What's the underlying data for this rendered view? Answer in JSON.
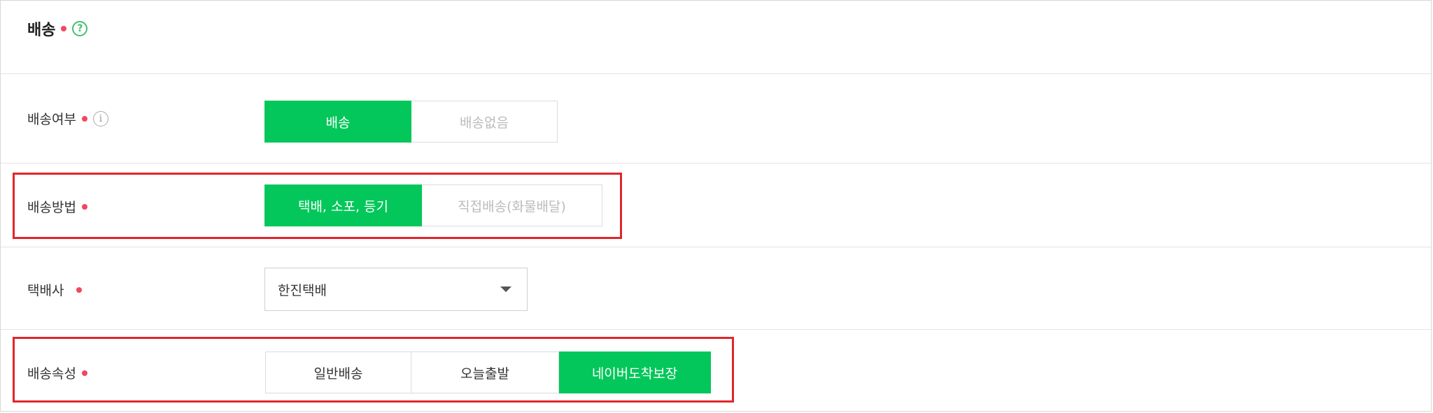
{
  "section": {
    "title": "배송",
    "help_icon": "question-circle-icon"
  },
  "rows": {
    "delivery_option": {
      "label": "배송여부",
      "info_icon": "info-circle-icon",
      "options": [
        "배송",
        "배송없음"
      ],
      "selected": "배송"
    },
    "delivery_method": {
      "label": "배송방법",
      "options": [
        "택배, 소포, 등기",
        "직접배송(화물배달)"
      ],
      "selected": "택배, 소포, 등기"
    },
    "courier": {
      "label": "택배사",
      "value": "한진택배"
    },
    "delivery_attribute": {
      "label": "배송속성",
      "options": [
        "일반배송",
        "오늘출발",
        "네이버도착보장"
      ],
      "selected": "네이버도착보장"
    }
  },
  "colors": {
    "accent_green": "#03c75a",
    "required_dot": "#f0475f",
    "highlight_red": "#e0262b"
  }
}
